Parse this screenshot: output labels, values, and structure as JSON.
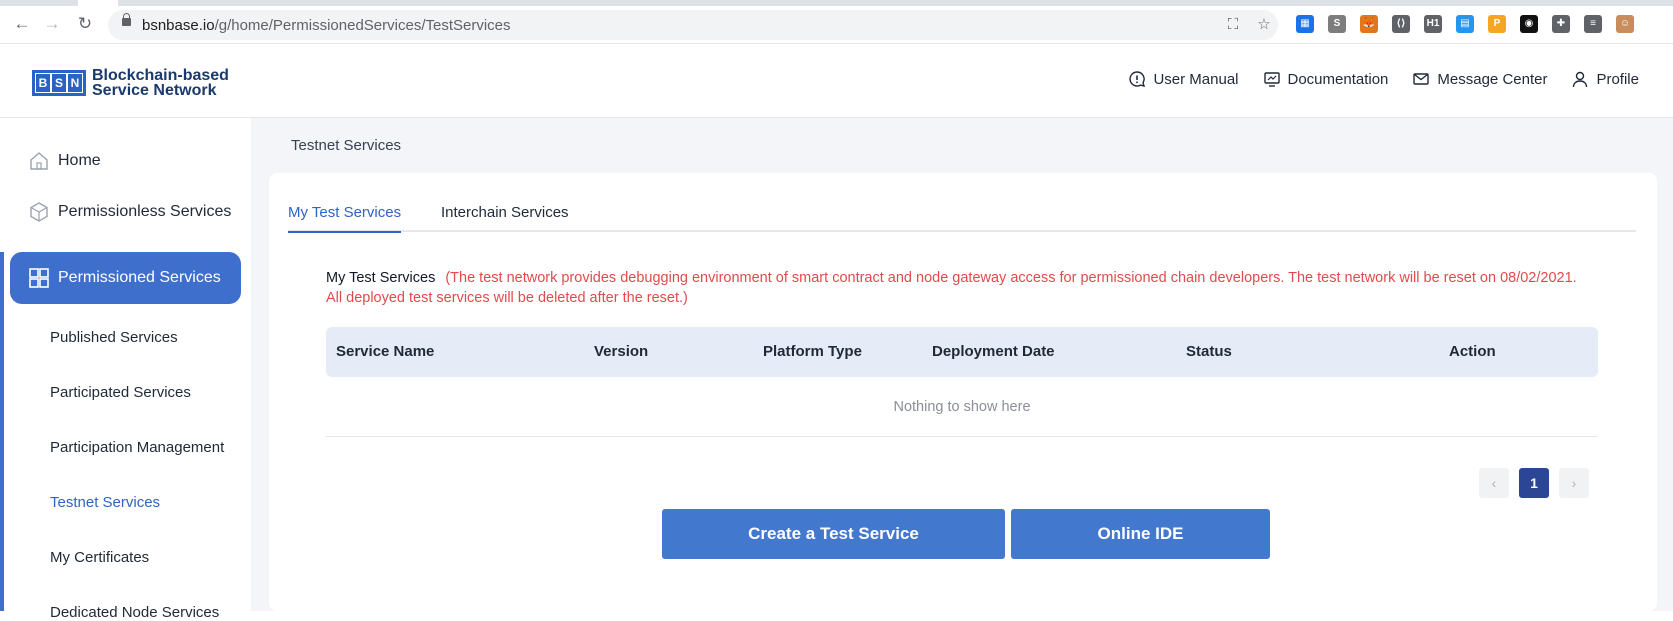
{
  "browser": {
    "url_domain": "bsnbase.io",
    "url_path": "/g/home/PermissionedServices/TestServices",
    "icons": [
      "back-icon",
      "forward-icon",
      "reload-icon",
      "lock-icon",
      "translate-icon",
      "star-icon"
    ]
  },
  "extensions": [
    {
      "name": "grid-extension-icon",
      "color": "#1a73e8",
      "glyph": "▦"
    },
    {
      "name": "s-extension-icon",
      "color": "#7d7d7d",
      "glyph": "S"
    },
    {
      "name": "fox-extension-icon",
      "color": "#e2761b",
      "glyph": "🦊"
    },
    {
      "name": "code-extension-icon",
      "color": "#5f6368",
      "glyph": "⟨⟩"
    },
    {
      "name": "h1-extension-icon",
      "color": "#5f6368",
      "glyph": "H1"
    },
    {
      "name": "book-extension-icon",
      "color": "#2196f3",
      "glyph": "▤"
    },
    {
      "name": "p-extension-icon",
      "color": "#f5a623",
      "glyph": "P"
    },
    {
      "name": "glasses-extension-icon",
      "color": "#111111",
      "glyph": "◉"
    },
    {
      "name": "puzzle-extension-icon",
      "color": "#5f6368",
      "glyph": "✚"
    },
    {
      "name": "playlist-extension-icon",
      "color": "#5f6368",
      "glyph": "≡"
    },
    {
      "name": "avatar-icon",
      "color": "#c98d5c",
      "glyph": "☺"
    }
  ],
  "logo": {
    "letters": [
      "B",
      "S",
      "N"
    ],
    "line1": "Blockchain-based",
    "line2": "Service Network",
    "brand_color": "#2a63c6"
  },
  "header": {
    "links": [
      {
        "label": "User Manual",
        "icon": "info-bubble-icon"
      },
      {
        "label": "Documentation",
        "icon": "monitor-icon"
      },
      {
        "label": "Message Center",
        "icon": "mail-icon"
      },
      {
        "label": "Profile",
        "icon": "user-icon"
      }
    ]
  },
  "sidebar": {
    "home": "Home",
    "permissionless": "Permissionless Services",
    "permissioned": "Permissioned Services",
    "sub": {
      "published": "Published Services",
      "participated": "Participated Services",
      "participation_mgmt": "Participation Management",
      "testnet": "Testnet Services",
      "certificates": "My Certificates",
      "dedicated": "Dedicated Node Services"
    },
    "accent_color": "#3e6fcc"
  },
  "main": {
    "breadcrumb": "Testnet Services",
    "tabs": [
      "My Test Services",
      "Interchain Services"
    ],
    "notice_title": "My Test Services",
    "notice_text": "(The test network provides debugging environment of smart contract and node gateway access for permissioned chain developers. The test network will be reset on 08/02/2021. All deployed test services will be deleted after the reset.)",
    "warn_color": "#e14b4b",
    "table": {
      "columns": [
        "Service Name",
        "Version",
        "Platform Type",
        "Deployment Date",
        "Status",
        "Action"
      ],
      "empty": "Nothing to show here"
    },
    "pagination": {
      "prev": "‹",
      "current": "1",
      "next": "›"
    },
    "buttons": {
      "create": "Create a Test Service",
      "ide": "Online IDE"
    }
  }
}
